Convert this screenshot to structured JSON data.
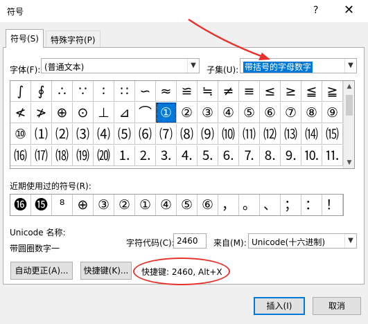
{
  "window": {
    "title": "符号",
    "help": "?",
    "close": "✕"
  },
  "tabs": [
    {
      "label": "符号(S)"
    },
    {
      "label": "特殊字符(P)"
    }
  ],
  "font": {
    "label": "字体(F):",
    "value": "(普通文本)"
  },
  "subset": {
    "label": "子集(U):",
    "value": "带括号的字母数字"
  },
  "grid": {
    "rows": [
      [
        "∫",
        "∮",
        "∴",
        "∵",
        "∶",
        "∷",
        "∽",
        "≈",
        "≌",
        "≒",
        "≠",
        "≡",
        "≤",
        "≥",
        "≦",
        "≧"
      ],
      [
        "≮",
        "≯",
        "⊕",
        "⊙",
        "⊥",
        "⊿",
        "⌒",
        "①",
        "②",
        "③",
        "④",
        "⑤",
        "⑥",
        "⑦",
        "⑧",
        "⑨"
      ],
      [
        "⑩",
        "⑴",
        "⑵",
        "⑶",
        "⑷",
        "⑸",
        "⑹",
        "⑺",
        "⑻",
        "⑼",
        "⑽",
        "⑾",
        "⑿",
        "⒀",
        "⒁",
        "⒂"
      ],
      [
        "⒃",
        "⒄",
        "⒅",
        "⒆",
        "⒇",
        "⒈",
        "⒉",
        "⒊",
        "⒋",
        "⒌",
        "⒍",
        "⒎",
        "⒏",
        "⒐",
        "⒑",
        "⒒"
      ]
    ],
    "selected": "①"
  },
  "recent": {
    "label": "近期使用过的符号(R):",
    "items": [
      "⓰",
      "⓯",
      "⁸",
      "⊕",
      "③",
      "②",
      "①",
      "④",
      "⑤",
      "⑥",
      "，",
      "。",
      "、",
      "；",
      "：",
      "！"
    ]
  },
  "unicode": {
    "name_label": "Unicode 名称:",
    "name_value": "带圆圈数字一"
  },
  "char_code": {
    "label": "字符代码(C):",
    "value": "2460"
  },
  "from": {
    "label": "来自(M):",
    "value": "Unicode(十六进制)"
  },
  "buttons": {
    "autocorrect": "自动更正(A)...",
    "shortcut_key": "快捷键(K)...",
    "insert": "插入(I)",
    "cancel": "取消"
  },
  "shortcut_info": "快捷键: 2460, Alt+X",
  "colors": {
    "selection": "#0078d7",
    "annotation": "#e8312c"
  },
  "icons": {
    "dropdown": "chevron-down-icon",
    "help": "help-icon",
    "close": "close-icon"
  }
}
